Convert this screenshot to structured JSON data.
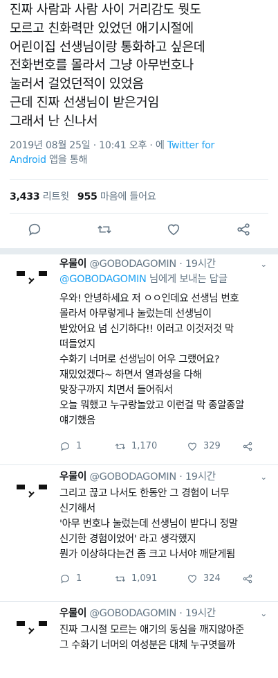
{
  "tweet": {
    "lines": [
      "진짜 사람과 사람 사이 거리감도 뭣도",
      "모르고 친화력만 있었던 애기시절에",
      "어린이집 선생님이랑 통화하고 싶은데",
      "전화번호를 몰라서 그냥 아무번호나",
      "눌러서 걸었던적이 있었음",
      "근데 진짜 선생님이 받은거임",
      "그래서 난 신나서"
    ],
    "timestamp": "2019년 08월 25일 · 10:41 오후 · 에",
    "via_1": "Twitter for",
    "via_2": "Android",
    "via_suffix": " 앱을 통해",
    "retweets": "3,433",
    "retweets_label": "리트윗",
    "likes": "955",
    "likes_label": "마음에 들어요"
  },
  "replies": [
    {
      "name": "우물이",
      "handle": "@GOBODAGOMIN · 19시간",
      "reply_to_handle": "@GOBODAGOMIN",
      "reply_to_suffix": " 님에게 보내는 답글",
      "lines": [
        "우와! 안녕하세요 저 ㅇㅇ인데요 선생님 번호",
        "몰라서 아무렇게나 눌렀는데 선생님이",
        "받았어요 넘 신기하다!! 이러고 이것저것 막",
        "떠들었지",
        "수화기 너머로 선생님이 어우 그랬어요?",
        "재밌었겠다~ 하면서 열과성을 다해",
        "맞장구까지 치면서 들어줘서",
        "오늘 뭐했고 누구랑놀았고 이런걸 막 종알종알",
        "얘기했음"
      ],
      "replies_count": "1",
      "retweets_count": "1,170",
      "likes_count": "329"
    },
    {
      "name": "우물이",
      "handle": "@GOBODAGOMIN · 19시간",
      "lines": [
        "그리고 끊고 나서도 한동안 그 경험이 너무",
        "신기해서",
        "'아무 번호나 눌렀는데 선생님이 받다니 정말",
        "신기한 경험이었어' 라고 생각했지",
        "뭔가 이상하다는건 좀 크고 나서야 깨닫게됨"
      ],
      "replies_count": "1",
      "retweets_count": "1,091",
      "likes_count": "324"
    },
    {
      "name": "우물이",
      "handle": "@GOBODAGOMIN · 19시간",
      "lines": [
        "진짜 그시절 모르는 애기의 동심을 깨지않아준",
        "그 수화기 너머의 여성분은 대체 누구엿을까"
      ]
    }
  ],
  "icons": {
    "reply": "reply-icon",
    "retweet": "retweet-icon",
    "like": "heart-icon",
    "share": "share-icon",
    "chevron": "chevron-down-icon"
  },
  "colors": {
    "link": "#1da1f2",
    "muted": "#657786",
    "text": "#14171a"
  }
}
